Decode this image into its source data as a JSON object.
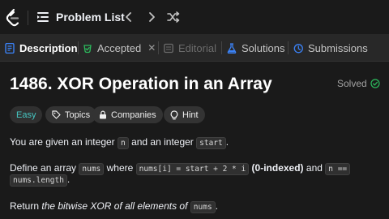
{
  "topbar": {
    "problem_list_label": "Problem List"
  },
  "tabs": {
    "description": "Description",
    "accepted": "Accepted",
    "editorial": "Editorial",
    "solutions": "Solutions",
    "submissions": "Submissions",
    "close_glyph": "✕"
  },
  "problem": {
    "title": "1486. XOR Operation in an Array",
    "status": "Solved",
    "difficulty": "Easy",
    "tags": {
      "topics": "Topics",
      "companies": "Companies",
      "hint": "Hint"
    }
  },
  "description": {
    "p1": {
      "t1": "You are given an integer ",
      "c1": "n",
      "t2": " and an integer ",
      "c2": "start",
      "t3": "."
    },
    "p2": {
      "t1": "Define an array ",
      "c1": "nums",
      "t2": " where ",
      "c2": "nums[i] = start + 2 * i",
      "t3": " ",
      "b1": "(0-indexed)",
      "t4": " and ",
      "c3": "n ==",
      "c4": "nums.length",
      "t5": "."
    },
    "p3": {
      "t1": "Return ",
      "i1": "the bitwise XOR of all elements of",
      "t2": " ",
      "c1": "nums",
      "t3": "."
    }
  },
  "colors": {
    "accent_easy": "#46c6c2",
    "solved_check": "#2cbb5d",
    "accepted_icon": "#2cbb5d",
    "description_icon": "#3b82f6",
    "solutions_icon": "#3b82f6",
    "submissions_icon": "#3b82f6",
    "editorial_icon": "#6b6b6b"
  },
  "icons": {
    "logo": "leetcode-logo",
    "problem_list": "list-icon",
    "prev": "chevron-left-icon",
    "next": "chevron-right-icon",
    "shuffle": "shuffle-icon",
    "topics": "tag-icon",
    "companies": "lock-icon",
    "hint": "lightbulb-icon",
    "solved": "check-circle-icon"
  }
}
